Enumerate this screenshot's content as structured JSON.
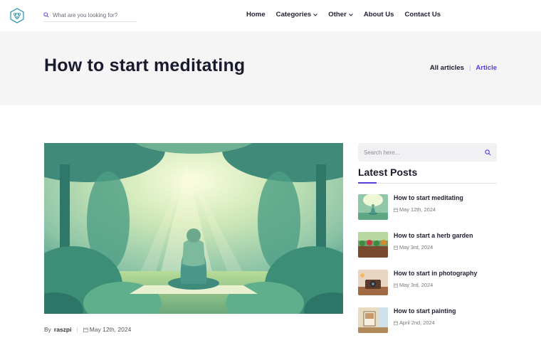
{
  "header": {
    "search_placeholder": "What are you looking for?",
    "nav": {
      "home": "Home",
      "categories": "Categories",
      "other": "Other",
      "about": "About Us",
      "contact": "Contact Us"
    }
  },
  "page": {
    "title": "How to start meditating",
    "breadcrumb": {
      "all": "All articles",
      "current": "Article"
    }
  },
  "article": {
    "by_label": "By",
    "author": "raszpi",
    "date": "May 12th, 2024"
  },
  "sidebar": {
    "search_placeholder": "Search here...",
    "latest_title": "Latest Posts",
    "posts": [
      {
        "title": "How to start meditating",
        "date": "May 12th, 2024"
      },
      {
        "title": "How to start a herb garden",
        "date": "May 3rd, 2024"
      },
      {
        "title": "How to start in photography",
        "date": "May 3rd, 2024"
      },
      {
        "title": "How to start painting",
        "date": "April 2nd, 2024"
      }
    ]
  },
  "colors": {
    "accent": "#5a3fd8",
    "logo": "#3a9bb0",
    "band": "#f5f5f5"
  }
}
